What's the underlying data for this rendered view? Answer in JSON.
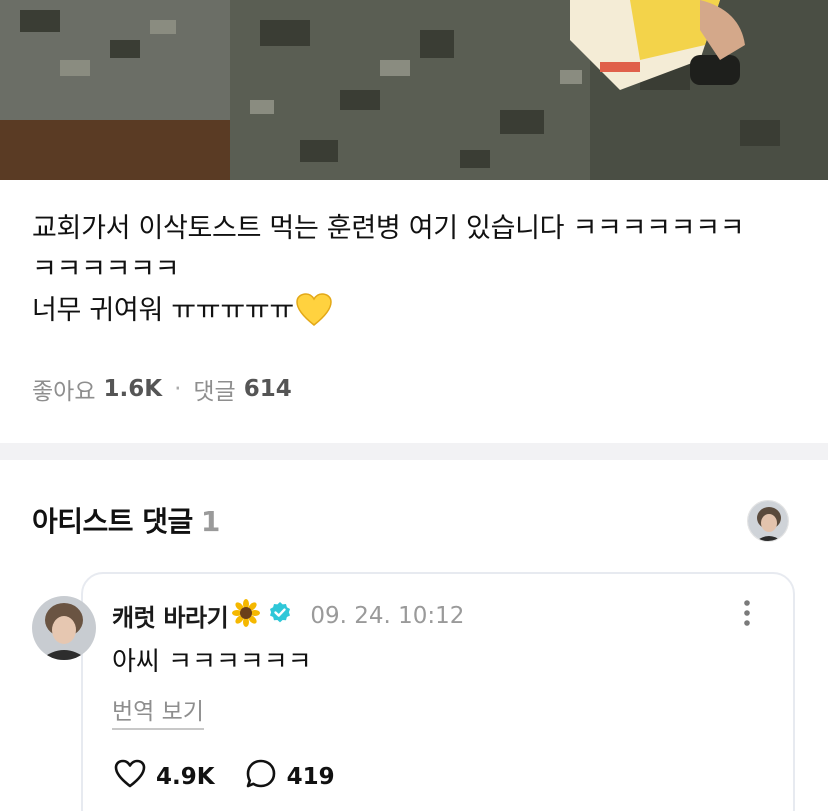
{
  "post": {
    "caption": "교회가서 이삭토스트 먹는 훈련병 여기 있습니다 ㅋㅋㅋㅋㅋㅋㅋ\nㅋㅋㅋㅋㅋㅋ\n너무 귀여워 ㅠㅠㅠㅠㅠ",
    "caption_emoji": "yellow-heart",
    "likes_label": "좋아요",
    "likes_count": "1.6K",
    "comments_label": "댓글",
    "comments_count": "614"
  },
  "artist_comments": {
    "title": "아티스트 댓글",
    "count": "1",
    "comment": {
      "author": "캐럿 바라기",
      "author_emoji": "sunflower",
      "verified_icon": "verified-badge-icon",
      "timestamp": "09. 24. 10:12",
      "text": "아씨 ㅋㅋㅋㅋㅋㅋ",
      "translate_label": "번역 보기",
      "likes": "4.9K",
      "replies": "419"
    }
  },
  "colors": {
    "verified": "#2fc7d8",
    "divider": "#f2f2f4",
    "muted": "#8e8e8e"
  }
}
